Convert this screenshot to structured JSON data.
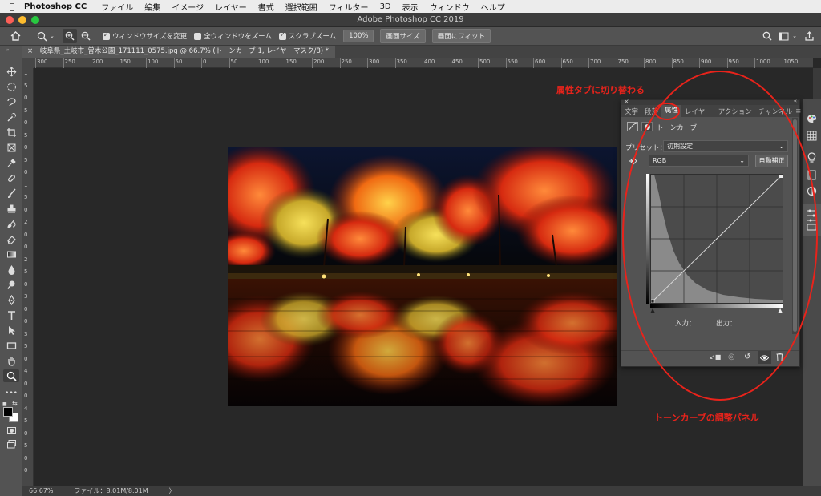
{
  "menubar": {
    "app_name": "Photoshop CC",
    "items": [
      "ファイル",
      "編集",
      "イメージ",
      "レイヤー",
      "書式",
      "選択範囲",
      "フィルター",
      "3D",
      "表示",
      "ウィンドウ",
      "ヘルプ"
    ]
  },
  "window": {
    "title": "Adobe Photoshop CC 2019"
  },
  "options_bar": {
    "resize_windows_label": "ウィンドウサイズを変更",
    "resize_windows_checked": true,
    "zoom_all_label": "全ウィンドウをズーム",
    "zoom_all_checked": false,
    "scrubby_zoom_label": "スクラブズーム",
    "scrubby_zoom_checked": true,
    "zoom_value": "100%",
    "fit_screen_label": "画面サイズ",
    "fill_screen_label": "画面にフィット"
  },
  "document": {
    "tab_title": "岐阜県_土岐市_曽木公園_171111_0575.jpg @ 66.7% (トーンカーブ 1, レイヤーマスク/8) *"
  },
  "ruler": {
    "h_labels": [
      "300",
      "250",
      "200",
      "150",
      "100",
      "50",
      "0",
      "50",
      "100",
      "150",
      "200",
      "250",
      "300",
      "350",
      "400",
      "450",
      "500",
      "550",
      "600",
      "650",
      "700",
      "750",
      "800",
      "850",
      "900",
      "950",
      "1000",
      "1050"
    ],
    "v_labels": [
      "1",
      "5",
      "0",
      "5",
      "0",
      "5",
      "0",
      "5",
      "0",
      "1",
      "5",
      "0",
      "2",
      "0",
      "0",
      "2",
      "5",
      "0",
      "3",
      "0",
      "0",
      "3",
      "5",
      "0",
      "4",
      "0",
      "0",
      "4",
      "5",
      "0",
      "5",
      "0",
      "0"
    ]
  },
  "status_bar": {
    "zoom": "66.67%",
    "file_info": "ファイル：8.01M/8.01M",
    "arrow": "〉"
  },
  "properties_panel": {
    "tabs": [
      "文字",
      "段落",
      "属性",
      "レイヤー",
      "アクション",
      "チャンネル"
    ],
    "active_tab": "属性",
    "adjustment_name": "トーンカーブ",
    "preset_label": "プリセット：",
    "preset_value": "初期設定",
    "channel_value": "RGB",
    "auto_button": "自動補正",
    "input_label": "入力：",
    "output_label": "出力："
  },
  "annotations": {
    "tab_switch": "属性タブに切り替わる",
    "panel_label": "トーンカーブの調整パネル",
    "color": "#e8231b"
  }
}
